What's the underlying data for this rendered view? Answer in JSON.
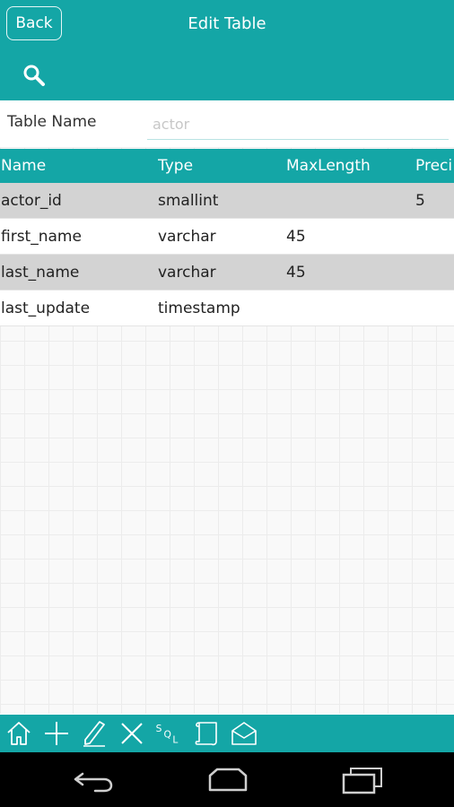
{
  "header": {
    "back_label": "Back",
    "title": "Edit Table",
    "search_icon": "search-icon"
  },
  "table_name": {
    "label": "Table Name",
    "placeholder": "actor",
    "value": ""
  },
  "columns": [
    "Name",
    "Type",
    "MaxLength",
    "Preci"
  ],
  "rows": [
    {
      "name": "actor_id",
      "type": "smallint",
      "maxlength": "",
      "precision": "5"
    },
    {
      "name": "first_name",
      "type": "varchar",
      "maxlength": "45",
      "precision": ""
    },
    {
      "name": "last_name",
      "type": "varchar",
      "maxlength": "45",
      "precision": ""
    },
    {
      "name": "last_update",
      "type": "timestamp",
      "maxlength": "",
      "precision": ""
    }
  ],
  "toolbar": {
    "sql_label": "SQL",
    "icons": [
      "home-icon",
      "add-icon",
      "edit-icon",
      "delete-icon",
      "sql-icon",
      "script-icon",
      "envelope-icon"
    ]
  },
  "colors": {
    "accent": "#14a6a6",
    "row_alt": "#d3d3d3",
    "nav_bar": "#000000"
  }
}
